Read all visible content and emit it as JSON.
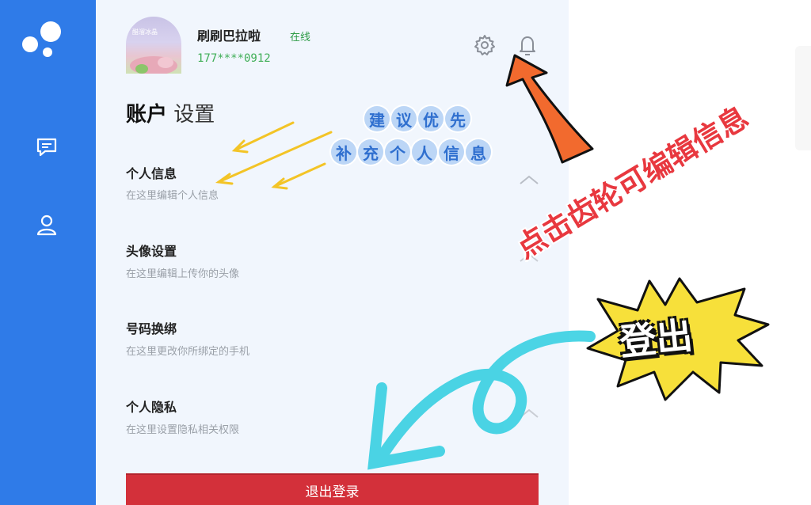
{
  "nav": {
    "items": [
      {
        "icon": "chat-icon"
      },
      {
        "icon": "user-icon"
      }
    ]
  },
  "profile": {
    "avatar_text": "醋溜冰晶",
    "name": "刷刷巴拉啦",
    "status": "在线",
    "phone": "177****0912"
  },
  "page": {
    "title_bold": "账户",
    "title_light": "设置"
  },
  "settings": [
    {
      "title": "个人信息",
      "desc": "在这里编辑个人信息"
    },
    {
      "title": "头像设置",
      "desc": "在这里编辑上传你的头像"
    },
    {
      "title": "号码换绑",
      "desc": "在这里更改你所绑定的手机"
    },
    {
      "title": "个人隐私",
      "desc": "在这里设置隐私相关权限"
    }
  ],
  "logout_label": "退出登录",
  "annotations": {
    "bubble_line1": [
      "建",
      "议",
      "优",
      "先"
    ],
    "bubble_line2": [
      "补",
      "充",
      "个",
      "人",
      "信",
      "息"
    ],
    "red_hint": "点击齿轮可编辑信息",
    "burst": "登出"
  },
  "colors": {
    "nav": "#2f7be8",
    "status": "#2e9b46",
    "logout": "#d3303a",
    "hint": "#e8383f"
  }
}
